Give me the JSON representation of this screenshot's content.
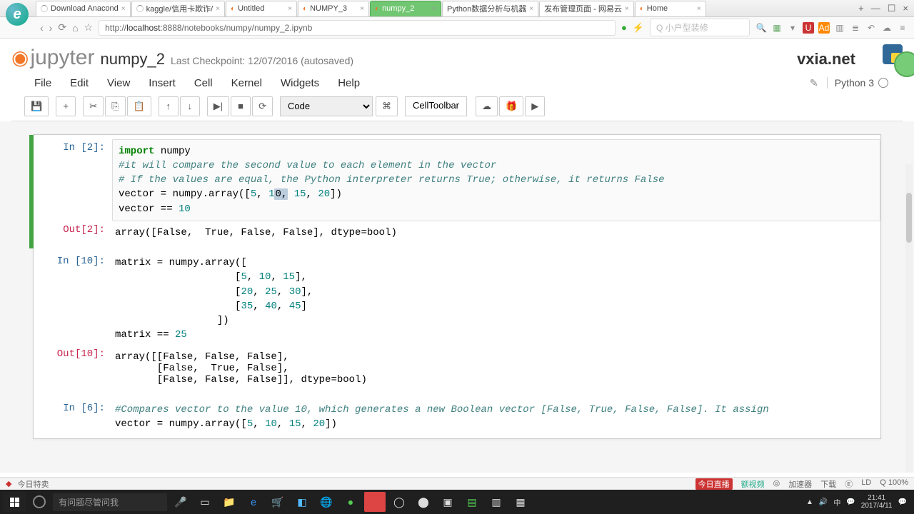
{
  "browser": {
    "tabs": [
      {
        "label": "Download Anacond"
      },
      {
        "label": "kaggle/信用卡欺诈/"
      },
      {
        "label": "Untitled"
      },
      {
        "label": "NUMPY_3"
      },
      {
        "label": "numpy_2"
      },
      {
        "label": "Python数据分析与机器"
      },
      {
        "label": "发布管理页面 - 网易云"
      },
      {
        "label": "Home"
      }
    ],
    "active_tab_index": 4,
    "url": "http://localhost:8888/notebooks/numpy/numpy_2.ipynb",
    "host": "localhost",
    "search_placeholder": "小户型装修"
  },
  "jupyter": {
    "logo_text": "jupyter",
    "notebook_name": "numpy_2",
    "checkpoint": "Last Checkpoint: 12/07/2016 (autosaved)",
    "watermark": "vxia.net",
    "menu": [
      "File",
      "Edit",
      "View",
      "Insert",
      "Cell",
      "Kernel",
      "Widgets",
      "Help"
    ],
    "kernel_name": "Python 3",
    "cell_type_selector": "Code",
    "cell_toolbar": "CellToolbar"
  },
  "cells": {
    "c1": {
      "in_label": "In [2]:",
      "code_lines": {
        "l1a": "import",
        "l1b": " numpy",
        "l2": "#it will compare the second value to each element in the vector",
        "l3": "# If the values are equal, the Python interpreter returns True; otherwise, it returns False",
        "l4a": "vector = numpy.array([",
        "l4n1": "5",
        "l4c1": ", ",
        "l4n2a": "1",
        "l4n2b": "0,",
        "l4c2": " ",
        "l4n3": "15",
        "l4c3": ", ",
        "l4n4": "20",
        "l4b": "])",
        "l5a": "vector == ",
        "l5n": "10"
      },
      "out_label": "Out[2]:",
      "output": "array([False,  True, False, False], dtype=bool)"
    },
    "c2": {
      "in_label": "In [10]:",
      "code": "matrix = numpy.array([\n                    [5, 10, 15],\n                    [20, 25, 30],\n                    [35, 40, 45]\n                 ])\nmatrix == 25",
      "code_html_l1": "matrix = numpy.array([",
      "code_html_l2a": "                    [",
      "n21": "5",
      "c21": ", ",
      "n22": "10",
      "c22": ", ",
      "n23": "15",
      "code_html_l2b": "],",
      "code_html_l3a": "                    [",
      "n31": "20",
      "c31": ", ",
      "n32": "25",
      "c32": ", ",
      "n33": "30",
      "code_html_l3b": "],",
      "code_html_l4a": "                    [",
      "n41": "35",
      "c41": ", ",
      "n42": "40",
      "c42": ", ",
      "n43": "45",
      "code_html_l4b": "]",
      "code_html_l5": "                 ])",
      "code_html_l6a": "matrix == ",
      "n6": "25",
      "out_label": "Out[10]:",
      "output": "array([[False, False, False],\n       [False,  True, False],\n       [False, False, False]], dtype=bool)"
    },
    "c3": {
      "in_label": "In [6]:",
      "code_l1": "#Compares vector to the value 10, which generates a new Boolean vector [False, True, False, False]. It assign",
      "code_l2a": "vector = numpy.array([",
      "n1": "5",
      "c1": ", ",
      "n2": "10",
      "c2": ", ",
      "n3": "15",
      "c3": ", ",
      "n4": "20",
      "code_l2b": "])"
    }
  },
  "statusbar": {
    "left": "今日特卖",
    "items": [
      "今日直播",
      "额视频",
      "◎",
      "加速器",
      "下载",
      "Ⓔ",
      "LD",
      "Q 100%"
    ]
  },
  "taskbar": {
    "search": "有问题尽管问我",
    "time": "21:41",
    "date": "2017/4/11"
  }
}
